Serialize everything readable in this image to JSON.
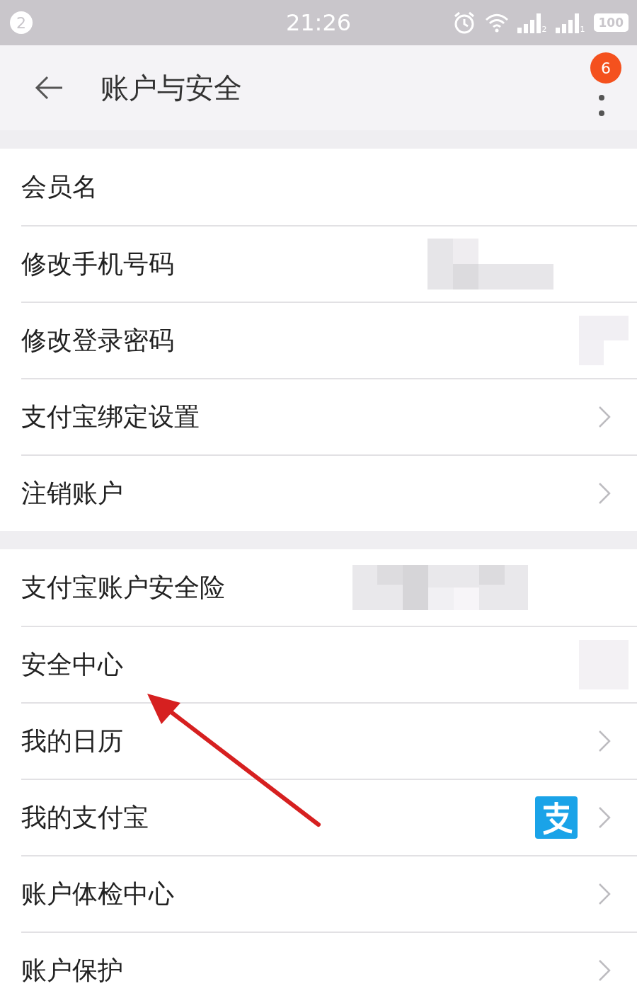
{
  "status_bar": {
    "notification_count": "2",
    "time": "21:26",
    "sim_1": "2",
    "sim_2": "1",
    "battery": "100"
  },
  "header": {
    "title": "账户与安全",
    "menu_badge": "6"
  },
  "sections": [
    {
      "rows": [
        {
          "label": "会员名",
          "kind": "plain"
        },
        {
          "label": "修改手机号码",
          "kind": "redacted"
        },
        {
          "label": "修改登录密码",
          "kind": "redacted"
        },
        {
          "label": "支付宝绑定设置",
          "kind": "chevron"
        },
        {
          "label": "注销账户",
          "kind": "chevron"
        }
      ]
    },
    {
      "rows": [
        {
          "label": "支付宝账户安全险",
          "kind": "redacted"
        },
        {
          "label": "安全中心",
          "kind": "redacted"
        },
        {
          "label": "我的日历",
          "kind": "chevron"
        },
        {
          "label": "我的支付宝",
          "kind": "alipay"
        },
        {
          "label": "账户体检中心",
          "kind": "chevron"
        },
        {
          "label": "账户保护",
          "kind": "chevron"
        }
      ]
    }
  ]
}
